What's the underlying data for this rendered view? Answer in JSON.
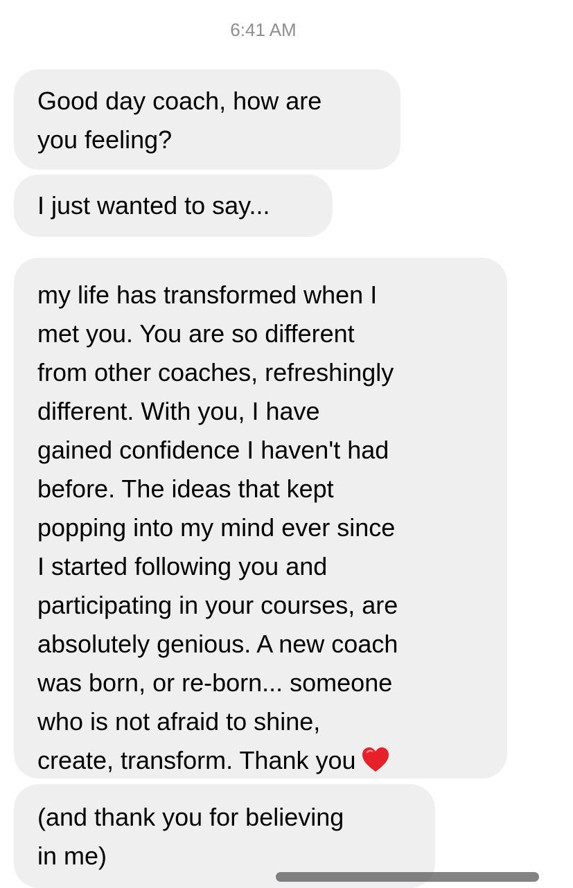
{
  "timestamp": "6:41 AM",
  "messages": [
    {
      "text": "Good day coach, how are\nyou feeling?"
    },
    {
      "text": "I just wanted to say..."
    },
    {
      "text": "my life has transformed when I\nmet you. You are so different\nfrom other coaches, refreshingly\ndifferent. With you, I have\ngained confidence I haven't had\nbefore. The ideas that kept\npopping into my mind ever since\nI started following you and\nparticipating in your courses, are\nabsolutely genious. A new coach\nwas born, or re-born... someone\nwho is not afraid to shine,\ncreate, transform. Thank you",
      "emoji": "red-heart"
    },
    {
      "text": "(and thank you for believing\nin me)"
    }
  ],
  "colors": {
    "bubble": "#efeff0",
    "timestamp": "#8e8e93",
    "heart": "#e8202a"
  }
}
